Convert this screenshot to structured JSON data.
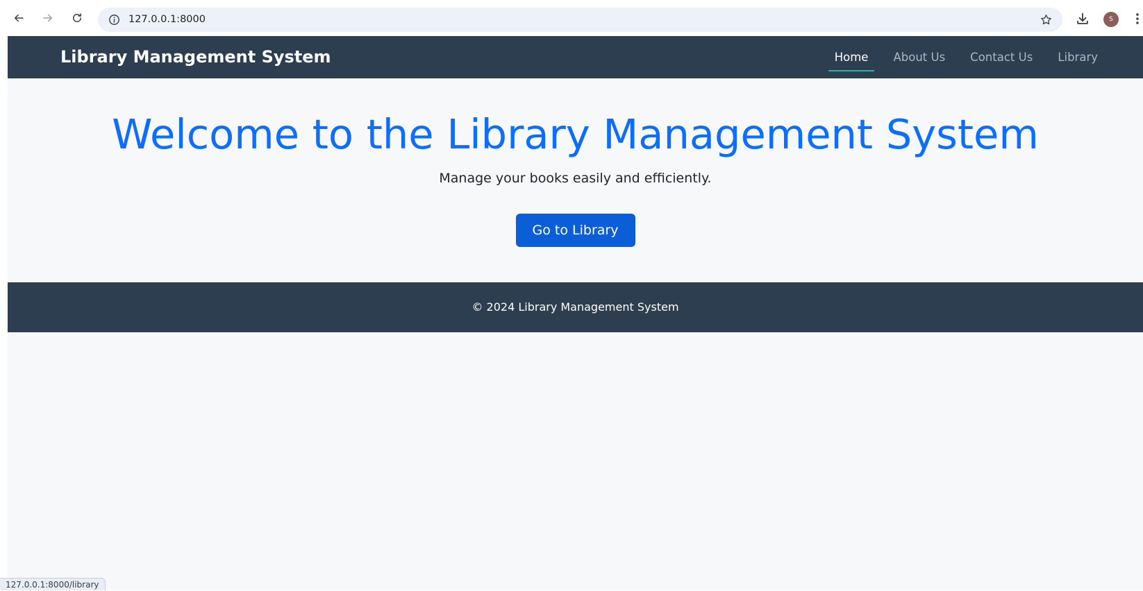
{
  "browser": {
    "url": "127.0.0.1:8000",
    "status_url": "127.0.0.1:8000/library",
    "profile_initial": "S",
    "icons": {
      "back": "arrow-left-icon",
      "forward": "arrow-right-icon",
      "reload": "reload-icon",
      "site_info": "info-icon",
      "bookmark": "star-icon",
      "downloads": "download-icon",
      "menu": "kebab-menu-icon"
    }
  },
  "header": {
    "brand": "Library Management System",
    "nav": [
      {
        "label": "Home",
        "active": true
      },
      {
        "label": "About Us",
        "active": false
      },
      {
        "label": "Contact Us",
        "active": false
      },
      {
        "label": "Library",
        "active": false
      }
    ]
  },
  "hero": {
    "title": "Welcome to the Library Management System",
    "subtitle": "Manage your books easily and efficiently.",
    "cta_label": "Go to Library"
  },
  "footer": {
    "text": "© 2024 Library Management System"
  },
  "colors": {
    "header_bg": "#2d3e50",
    "page_bg": "#f7f8fa",
    "title_blue": "#0d6efd",
    "button_blue": "#0b5ed7",
    "nav_active_underline": "#1abc9c",
    "nav_inactive": "#aeb6bf"
  }
}
